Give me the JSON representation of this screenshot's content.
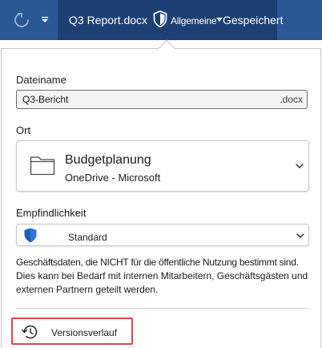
{
  "titlebar": {
    "filename": "Q3 Report.docx",
    "sensitivity_label": "Allgemeine",
    "status": "Gespeichert",
    "icons": {
      "undo": "undo-icon",
      "dropdown": "caret-down-icon",
      "shield": "shield-icon"
    }
  },
  "panel": {
    "filename_label": "Dateiname",
    "filename_value": "Q3-Bericht",
    "filename_ext": ".docx",
    "location_label": "Ort",
    "location": {
      "name": "Budgetplanung",
      "sub": "OneDrive - Microsoft",
      "icon": "folder-icon"
    },
    "sensitivity_label": "Empfindlichkeit",
    "sensitivity_value": "Standard",
    "description_line1": "Geschäftsdaten, die NICHT für die öffentliche Nutzung bestimmt sind.",
    "description_line2": "Dies kann bei Bedarf mit internen Mitarbeitern, Geschäftsgästen und externen Partnern geteilt werden.",
    "version_history": "Versionsverlauf"
  },
  "colors": {
    "titlebar": "#2b5797",
    "titlebar_active": "#1e3f73",
    "shield_blue": "#1f5fb3",
    "highlight_red": "#e0474c"
  }
}
